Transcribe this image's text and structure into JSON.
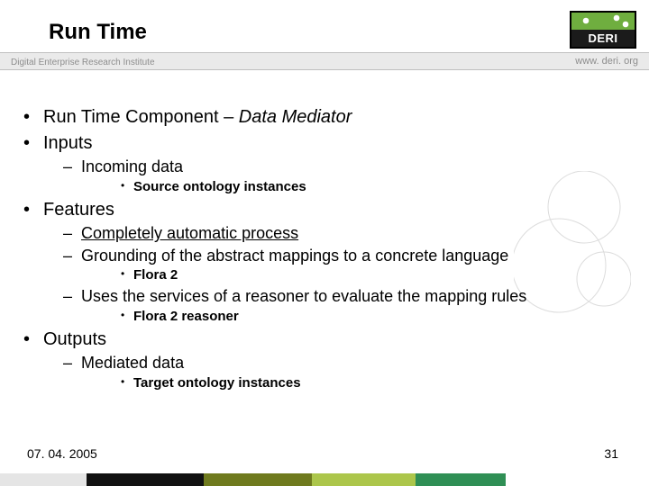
{
  "title": "Run Time",
  "band": {
    "left": "Digital Enterprise Research Institute",
    "right": "www. deri. org"
  },
  "logo": {
    "name": "DERI"
  },
  "bullets": {
    "l1_0_plain": "Run Time Component – ",
    "l1_0_italic": "Data Mediator",
    "l1_1": "Inputs",
    "l1_1_l2_0": "Incoming data",
    "l1_1_l2_0_l3_0": "Source ontology instances",
    "l1_2": "Features",
    "l1_2_l2_0": "Completely automatic process",
    "l1_2_l2_1": "Grounding of the abstract mappings to a concrete language",
    "l1_2_l2_1_l3_0": "Flora 2",
    "l1_2_l2_2": "Uses the services of a reasoner to evaluate the mapping rules",
    "l1_2_l2_2_l3_0": "Flora 2 reasoner",
    "l1_3": "Outputs",
    "l1_3_l2_0": "Mediated data",
    "l1_3_l2_0_l3_0": "Target ontology instances"
  },
  "footer": {
    "date": "07. 04. 2005",
    "page": "31"
  }
}
